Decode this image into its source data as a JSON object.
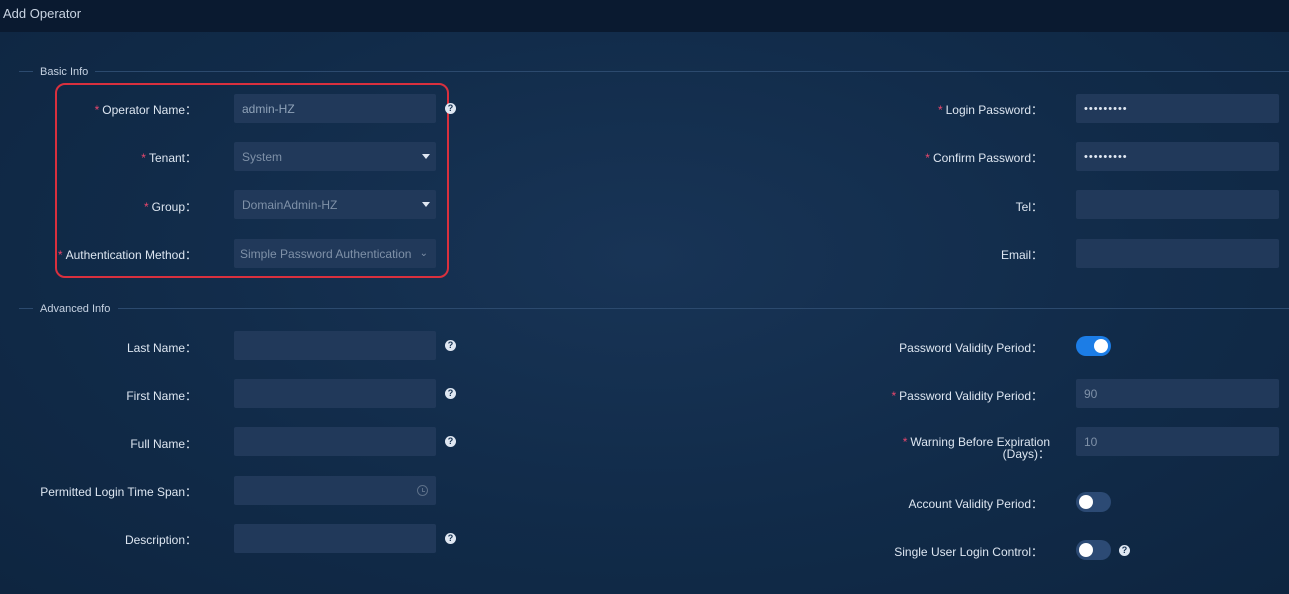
{
  "window": {
    "title": "Add Operator"
  },
  "sections": {
    "basic": "Basic Info",
    "advanced": "Advanced Info"
  },
  "basic": {
    "operator_name": {
      "label": "Operator Name：",
      "value": "admin-HZ"
    },
    "tenant": {
      "label": "Tenant：",
      "value": "System"
    },
    "group": {
      "label": "Group：",
      "value": "DomainAdmin-HZ"
    },
    "auth_method": {
      "label": "Authentication Method：",
      "value": "Simple Password Authentication"
    },
    "login_password": {
      "label": "Login Password：",
      "value": "•••••••••"
    },
    "confirm_password": {
      "label": "Confirm Password：",
      "value": "•••••••••"
    },
    "tel": {
      "label": "Tel：",
      "value": ""
    },
    "email": {
      "label": "Email：",
      "value": ""
    }
  },
  "advanced": {
    "last_name": {
      "label": "Last Name：",
      "value": ""
    },
    "first_name": {
      "label": "First Name：",
      "value": ""
    },
    "full_name": {
      "label": "Full Name：",
      "value": ""
    },
    "login_time_span": {
      "label": "Permitted Login Time Span：",
      "value": ""
    },
    "description": {
      "label": "Description：",
      "value": ""
    },
    "pwd_validity_toggle": {
      "label": "Password Validity Period：",
      "on": true
    },
    "pwd_validity_days": {
      "label": "Password Validity Period：",
      "value": "90"
    },
    "warning_before_exp": {
      "label_line1": "Warning Before Expiration",
      "label_line2": "(Days)：",
      "value": "10"
    },
    "account_validity": {
      "label": "Account Validity Period：",
      "on": false
    },
    "single_user_login": {
      "label": "Single User Login Control：",
      "on": false
    }
  },
  "symbols": {
    "required": "*",
    "help": "?",
    "chevron": "⌄"
  },
  "colors": {
    "accent": "#1c7de6",
    "required": "#e9476d",
    "highlight": "#d9303e"
  },
  "icons": [
    "help-icon",
    "caret-down-icon",
    "chevron-down-icon",
    "clock-icon"
  ]
}
